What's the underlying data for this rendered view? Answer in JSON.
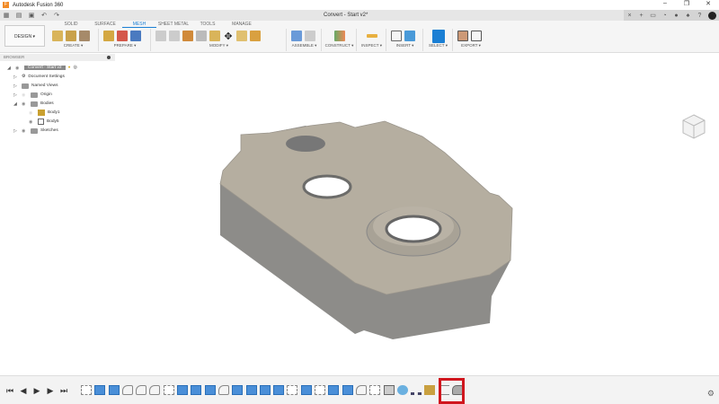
{
  "app_title": "Autodesk Fusion 360",
  "window_controls": [
    "–",
    "❐",
    "✕"
  ],
  "document_tab": {
    "title": "Convert - Start v2*",
    "close": "×"
  },
  "ribbon": {
    "workspace": "DESIGN ▾",
    "tabs": [
      "SOLID",
      "SURFACE",
      "MESH",
      "SHEET METAL",
      "TOOLS",
      "MANAGE"
    ],
    "active_tab": "MESH",
    "groups": [
      "CREATE ▾",
      "PREPARE ▾",
      "MODIFY ▾",
      "ASSEMBLE ▾",
      "CONSTRUCT ▾",
      "INSPECT ▾",
      "INSERT ▾",
      "SELECT ▾",
      "EXPORT ▾"
    ]
  },
  "browser": {
    "header": "BROWSER",
    "root": "Convert - Start v2",
    "items": [
      "Document Settings",
      "Named Views",
      "Origin",
      "Bodies",
      "Body1",
      "Body5",
      "Sketches"
    ]
  },
  "timeline": {
    "controls": [
      "⏮",
      "◀",
      "▶",
      "▶",
      "⏭"
    ],
    "features": [
      "sketch",
      "extrude",
      "extrude",
      "fillet",
      "fillet",
      "fillet",
      "sketch",
      "extrude",
      "extrude",
      "extrude",
      "fillet",
      "extrude",
      "extrude",
      "extrude",
      "extrude",
      "sketch",
      "extrude",
      "sketch",
      "extrude",
      "extrude",
      "fillet",
      "sketch",
      "shell",
      "form",
      "pattern",
      "joint",
      "bracket",
      "mesh-convert"
    ]
  },
  "colors": {
    "accent": "#1a7fd4",
    "highlight": "#d0161e",
    "model_top": "#b5aea0",
    "model_side": "#8d8c89"
  }
}
